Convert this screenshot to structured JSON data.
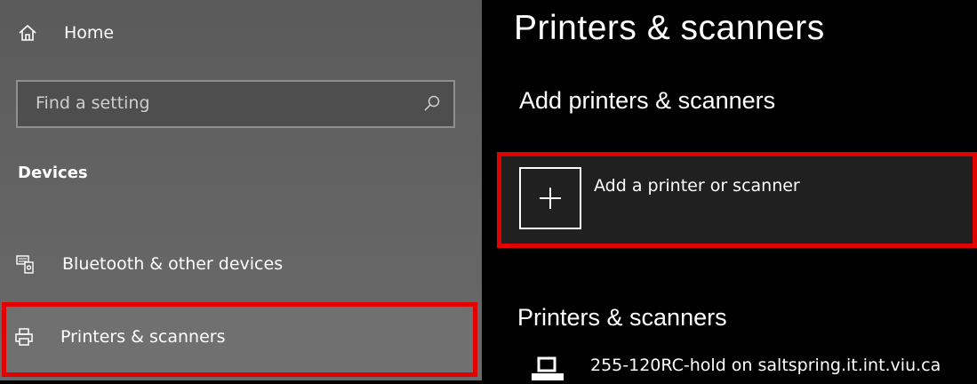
{
  "sidebar": {
    "home": {
      "label": "Home",
      "icon": "home-icon"
    },
    "search": {
      "placeholder": "Find a setting",
      "icon": "search-icon"
    },
    "section_heading": "Devices",
    "items": [
      {
        "label": "Bluetooth & other devices",
        "icon": "bluetooth-devices-icon"
      },
      {
        "label": "Printers & scanners",
        "icon": "printer-icon",
        "selected": true
      }
    ]
  },
  "main": {
    "title": "Printers & scanners",
    "add_section_heading": "Add printers & scanners",
    "add_button_label": "Add a printer or scanner",
    "list_heading": "Printers & scanners",
    "printers": [
      {
        "name": "255-120RC-hold on saltspring.it.int.viu.ca",
        "icon": "printer-icon"
      }
    ]
  },
  "colors": {
    "highlight_border": "#e30000",
    "sidebar_bg": "#636363",
    "main_bg": "#000000",
    "text": "#ffffff"
  }
}
